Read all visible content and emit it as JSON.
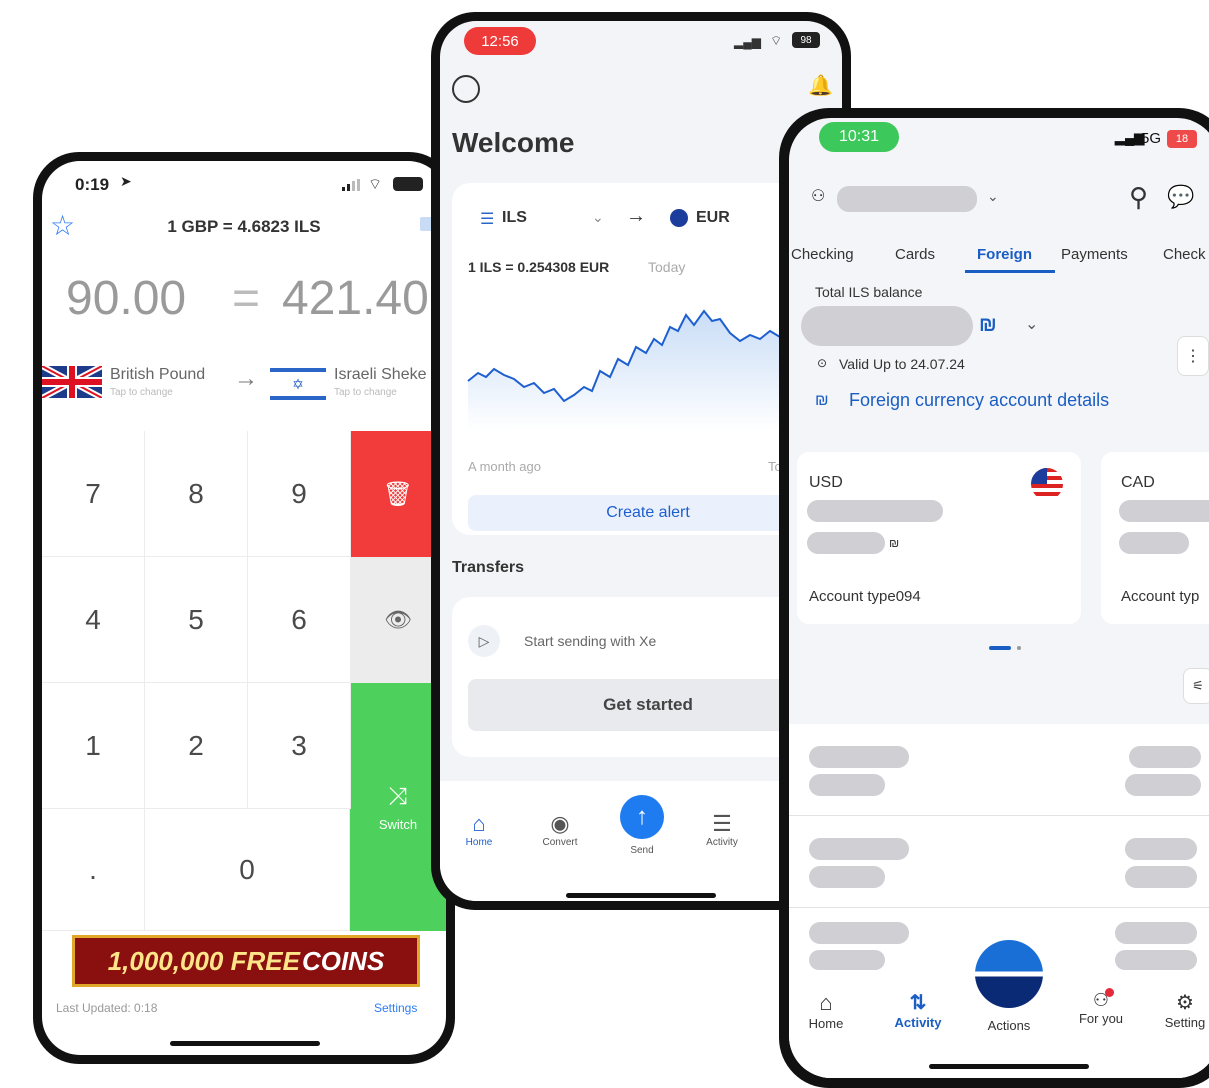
{
  "phone1": {
    "status_time": "0:19",
    "rate_line": "1 GBP = 4.6823 ILS",
    "from_amount": "90.00",
    "equals": "=",
    "to_amount": "421.40",
    "from_currency": "British Pound",
    "to_currency": "Israeli Sheke",
    "tap_hint": "Tap to change",
    "keys": [
      "7",
      "8",
      "9",
      "4",
      "5",
      "6",
      "1",
      "2",
      "3",
      ".",
      "0"
    ],
    "switch_label": "Switch",
    "ad_text_1": "1,000,000 FREE",
    "ad_text_2": "COINS",
    "last_updated": "Last Updated: 0:18",
    "settings": "Settings"
  },
  "phone2": {
    "status_time": "12:56",
    "battery": "98",
    "welcome": "Welcome",
    "from_code": "ILS",
    "to_code": "EUR",
    "rate_line": "1 ILS = 0.254308 EUR",
    "rate_when": "Today",
    "chart_start": "A month ago",
    "chart_end": "To",
    "create_alert": "Create alert",
    "transfers": "Transfers",
    "start_sending": "Start sending with Xe",
    "get_started": "Get started",
    "nav": [
      "Home",
      "Convert",
      "Send",
      "Activity"
    ]
  },
  "phone3": {
    "status_time": "10:31",
    "network": "5G",
    "battery": "18",
    "tabs": [
      "Checking",
      "Cards",
      "Foreign",
      "Payments",
      "Check"
    ],
    "active_tab": "Foreign",
    "total_label": "Total ILS balance",
    "shekel": "₪",
    "valid_up_to": "Valid Up to 24.07.24",
    "fx_details": "Foreign currency account details",
    "card1_code": "USD",
    "card1_type": "Account type094",
    "card2_code": "CAD",
    "card2_type": "Account typ",
    "nav": [
      "Home",
      "Activity",
      "Actions",
      "For you",
      "Setting"
    ],
    "accent": "#1a5ec4"
  }
}
